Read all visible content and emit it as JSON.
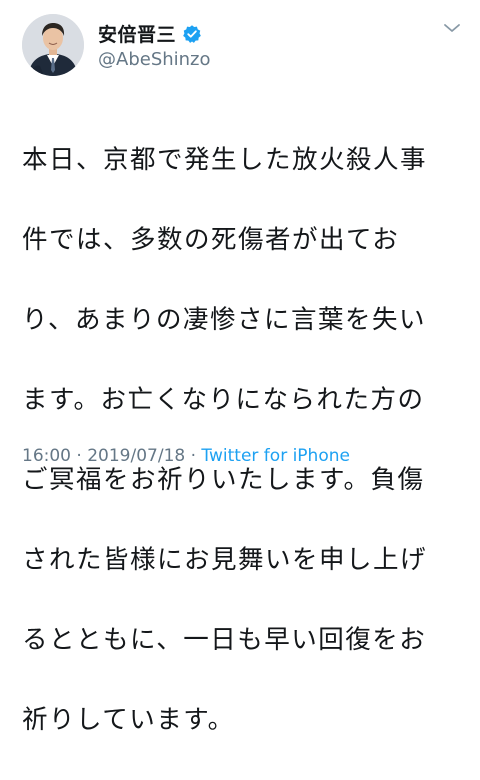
{
  "account": {
    "display_name": "安倍晋三",
    "handle": "@AbeShinzo",
    "verified_icon": "verified-badge-icon",
    "avatar_icon": "profile-avatar"
  },
  "tweet": {
    "lines": [
      "本日、京都で発生した放火殺人事",
      "件では、多数の死傷者が出てお",
      "り、あまりの凄惨さに言葉を失い",
      "ます。お亡くなりになられた方の",
      "ご冥福をお祈りいたします。負傷",
      "された皆様にお見舞いを申し上げ",
      "るとともに、一日も早い回復をお",
      "祈りしています。"
    ]
  },
  "meta": {
    "time": "16:00",
    "separator1": " · ",
    "date": "2019/07/18",
    "separator2": " · ",
    "source": "Twitter for iPhone"
  },
  "colors": {
    "text": "#14171a",
    "secondary": "#657786",
    "accent": "#1da1f2"
  }
}
